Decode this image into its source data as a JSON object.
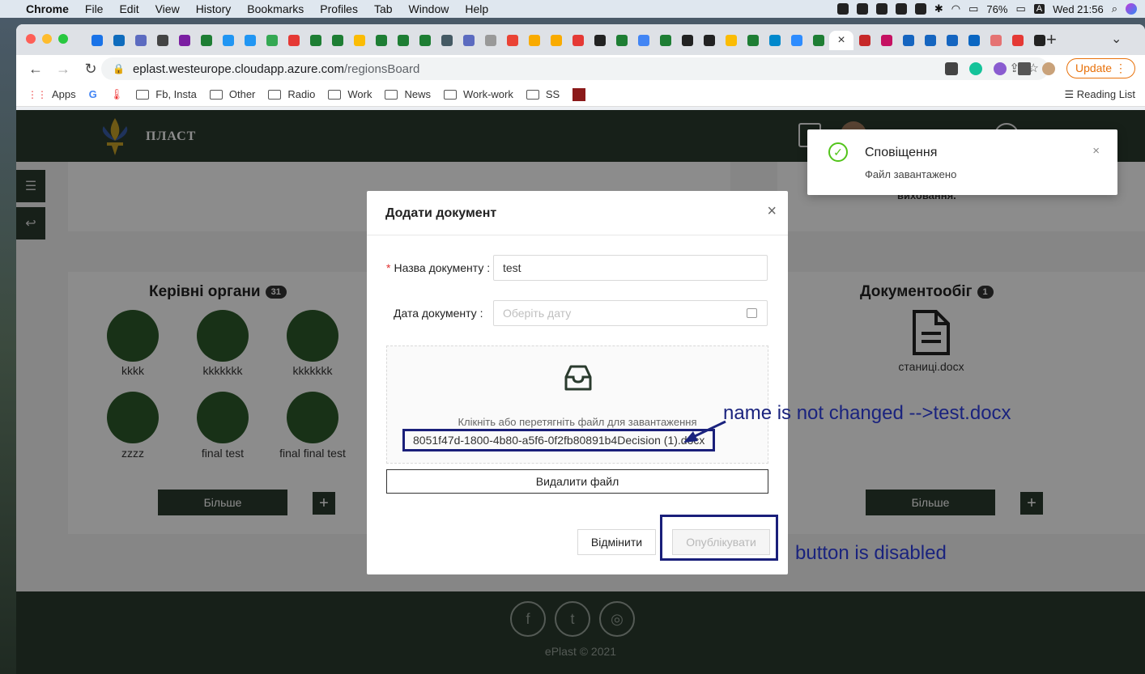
{
  "menubar": {
    "app": "Chrome",
    "items": [
      "File",
      "Edit",
      "View",
      "History",
      "Bookmarks",
      "Profiles",
      "Tab",
      "Window",
      "Help"
    ],
    "battery": "76%",
    "keyboard": "A",
    "clock": "Wed 21:56"
  },
  "browser": {
    "url_host": "eplast.westeurope.cloudapp.azure.com",
    "url_path": "/regionsBoard",
    "update_label": "Update",
    "bookmarks": [
      "Apps",
      "G",
      "Fb, Insta",
      "Other",
      "Radio",
      "Work",
      "News",
      "Work-work",
      "SS"
    ],
    "reading_list": "Reading List"
  },
  "app": {
    "brand": "ПЛАСТ",
    "bg_text": "виховання.",
    "governing": {
      "title": "Керівні органи",
      "count": "31",
      "members": [
        "kkkk",
        "kkkkkkk",
        "kkkkkkk",
        "zzzz",
        "final test",
        "final final test"
      ],
      "more_label": "Більше",
      "add_label": "+"
    },
    "docs": {
      "title": "Документообіг",
      "count": "1",
      "file": "станиці.docx",
      "more_label": "Більше",
      "add_label": "+"
    },
    "footer": {
      "copyright": "ePlast © 2021"
    }
  },
  "modal": {
    "title": "Додати документ",
    "close": "×",
    "name_label": "Назва документу",
    "name_required": "*",
    "name_value": "test",
    "date_label": "Дата документу",
    "date_placeholder": "Оберіть дату",
    "upload_hint": "Клікніть або перетягніть файл для завантаження",
    "file_name": "8051f47d-1800-4b80-a5f6-0f2fb80891b4Decision (1).docx",
    "delete_label": "Видалити файл",
    "cancel_label": "Відмінити",
    "publish_label": "Опублікувати"
  },
  "notification": {
    "title": "Сповіщення",
    "message": "Файл завантажено",
    "close": "×"
  },
  "annotations": {
    "name_note": "name is not changed -->test.docx",
    "button_note": "button is disabled",
    "color": "#1a237e"
  }
}
